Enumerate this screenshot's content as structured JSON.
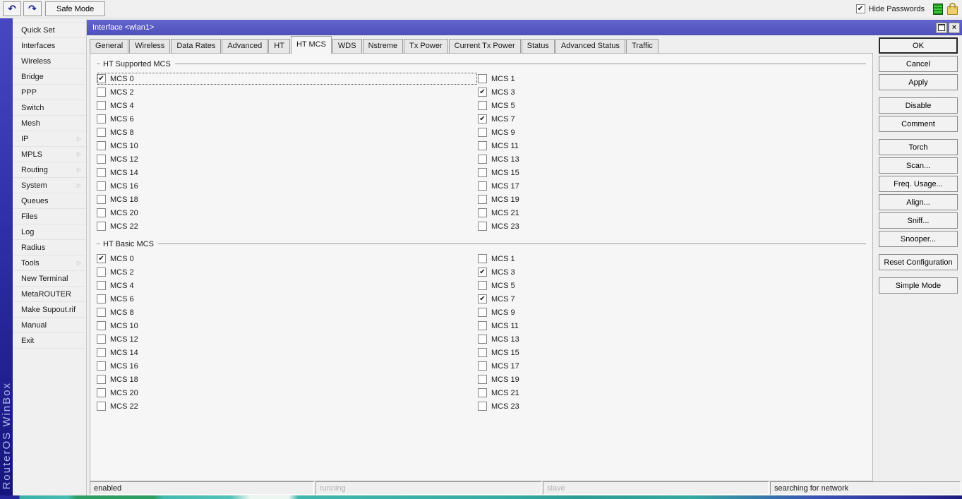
{
  "icons": {
    "undo": "↶",
    "redo": "↷",
    "close": "×",
    "check": "✔",
    "submenu_arrow": "▷"
  },
  "toolbar": {
    "safe_mode_label": "Safe Mode",
    "hide_passwords_label": "Hide Passwords",
    "hide_passwords_checked": true
  },
  "brand": {
    "vertical_text": "RouterOS WinBox"
  },
  "sidebar": {
    "items": [
      {
        "label": "Quick Set",
        "arrow": false
      },
      {
        "label": "Interfaces",
        "arrow": false
      },
      {
        "label": "Wireless",
        "arrow": false
      },
      {
        "label": "Bridge",
        "arrow": false
      },
      {
        "label": "PPP",
        "arrow": false
      },
      {
        "label": "Switch",
        "arrow": false
      },
      {
        "label": "Mesh",
        "arrow": false
      },
      {
        "label": "IP",
        "arrow": true
      },
      {
        "label": "MPLS",
        "arrow": true
      },
      {
        "label": "Routing",
        "arrow": true
      },
      {
        "label": "System",
        "arrow": true
      },
      {
        "label": "Queues",
        "arrow": false
      },
      {
        "label": "Files",
        "arrow": false
      },
      {
        "label": "Log",
        "arrow": false
      },
      {
        "label": "Radius",
        "arrow": false
      },
      {
        "label": "Tools",
        "arrow": true
      },
      {
        "label": "New Terminal",
        "arrow": false
      },
      {
        "label": "MetaROUTER",
        "arrow": false
      },
      {
        "label": "Make Supout.rif",
        "arrow": false
      },
      {
        "label": "Manual",
        "arrow": false
      },
      {
        "label": "Exit",
        "arrow": false
      }
    ]
  },
  "window": {
    "title": "Interface <wlan1>",
    "tabs": [
      "General",
      "Wireless",
      "Data Rates",
      "Advanced",
      "HT",
      "HT MCS",
      "WDS",
      "Nstreme",
      "Tx Power",
      "Current Tx Power",
      "Status",
      "Advanced Status",
      "Traffic"
    ],
    "active_tab": "HT MCS",
    "groups": [
      {
        "legend": "HT Supported MCS",
        "left": [
          {
            "label": "MCS 0",
            "checked": true,
            "focused": true
          },
          {
            "label": "MCS 2",
            "checked": false
          },
          {
            "label": "MCS 4",
            "checked": false
          },
          {
            "label": "MCS 6",
            "checked": false
          },
          {
            "label": "MCS 8",
            "checked": false
          },
          {
            "label": "MCS 10",
            "checked": false
          },
          {
            "label": "MCS 12",
            "checked": false
          },
          {
            "label": "MCS 14",
            "checked": false
          },
          {
            "label": "MCS 16",
            "checked": false
          },
          {
            "label": "MCS 18",
            "checked": false
          },
          {
            "label": "MCS 20",
            "checked": false
          },
          {
            "label": "MCS 22",
            "checked": false
          }
        ],
        "right": [
          {
            "label": "MCS 1",
            "checked": false
          },
          {
            "label": "MCS 3",
            "checked": true
          },
          {
            "label": "MCS 5",
            "checked": false
          },
          {
            "label": "MCS 7",
            "checked": true
          },
          {
            "label": "MCS 9",
            "checked": false
          },
          {
            "label": "MCS 11",
            "checked": false
          },
          {
            "label": "MCS 13",
            "checked": false
          },
          {
            "label": "MCS 15",
            "checked": false
          },
          {
            "label": "MCS 17",
            "checked": false
          },
          {
            "label": "MCS 19",
            "checked": false
          },
          {
            "label": "MCS 21",
            "checked": false
          },
          {
            "label": "MCS 23",
            "checked": false
          }
        ]
      },
      {
        "legend": "HT Basic MCS",
        "left": [
          {
            "label": "MCS 0",
            "checked": true
          },
          {
            "label": "MCS 2",
            "checked": false
          },
          {
            "label": "MCS 4",
            "checked": false
          },
          {
            "label": "MCS 6",
            "checked": false
          },
          {
            "label": "MCS 8",
            "checked": false
          },
          {
            "label": "MCS 10",
            "checked": false
          },
          {
            "label": "MCS 12",
            "checked": false
          },
          {
            "label": "MCS 14",
            "checked": false
          },
          {
            "label": "MCS 16",
            "checked": false
          },
          {
            "label": "MCS 18",
            "checked": false
          },
          {
            "label": "MCS 20",
            "checked": false
          },
          {
            "label": "MCS 22",
            "checked": false
          }
        ],
        "right": [
          {
            "label": "MCS 1",
            "checked": false
          },
          {
            "label": "MCS 3",
            "checked": true
          },
          {
            "label": "MCS 5",
            "checked": false
          },
          {
            "label": "MCS 7",
            "checked": true
          },
          {
            "label": "MCS 9",
            "checked": false
          },
          {
            "label": "MCS 11",
            "checked": false
          },
          {
            "label": "MCS 13",
            "checked": false
          },
          {
            "label": "MCS 15",
            "checked": false
          },
          {
            "label": "MCS 17",
            "checked": false
          },
          {
            "label": "MCS 19",
            "checked": false
          },
          {
            "label": "MCS 21",
            "checked": false
          },
          {
            "label": "MCS 23",
            "checked": false
          }
        ]
      }
    ],
    "side_buttons": [
      {
        "label": "OK",
        "default": true
      },
      {
        "label": "Cancel"
      },
      {
        "label": "Apply"
      },
      {
        "label": "Disable",
        "gap": true
      },
      {
        "label": "Comment"
      },
      {
        "label": "Torch",
        "gap": true
      },
      {
        "label": "Scan..."
      },
      {
        "label": "Freq. Usage..."
      },
      {
        "label": "Align..."
      },
      {
        "label": "Sniff..."
      },
      {
        "label": "Snooper..."
      },
      {
        "label": "Reset Configuration",
        "gap": true
      },
      {
        "label": "Simple Mode",
        "gap": true
      }
    ],
    "status_fields": [
      {
        "text": "enabled",
        "muted": false
      },
      {
        "text": "running",
        "muted": true
      },
      {
        "text": "slave",
        "muted": true
      },
      {
        "text": "searching for network",
        "muted": false
      }
    ]
  }
}
